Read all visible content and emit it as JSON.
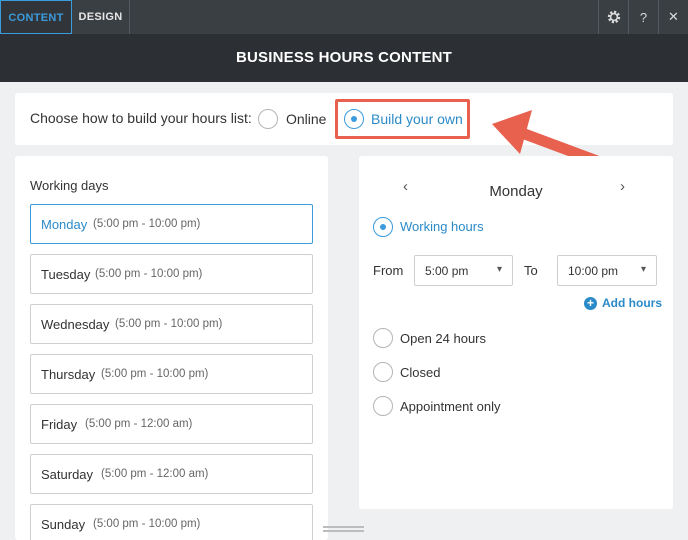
{
  "toolbar": {
    "tab_content": "CONTENT",
    "tab_design": "DESIGN",
    "help_label": "?",
    "close_label": "✕"
  },
  "header": {
    "title": "BUSINESS HOURS CONTENT"
  },
  "choose": {
    "label": "Choose how to build your hours list:",
    "option_online": "Online",
    "option_build": "Build your own",
    "selected": "Build your own"
  },
  "days": {
    "title": "Working days",
    "items": [
      {
        "name": "Monday",
        "hours": "(5:00 pm - 10:00 pm)"
      },
      {
        "name": "Tuesday",
        "hours": "(5:00 pm - 10:00 pm)"
      },
      {
        "name": "Wednesday",
        "hours": "(5:00 pm - 10:00 pm)"
      },
      {
        "name": "Thursday",
        "hours": "(5:00 pm - 10:00 pm)"
      },
      {
        "name": "Friday",
        "hours": "(5:00 pm - 12:00 am)"
      },
      {
        "name": "Saturday",
        "hours": "(5:00 pm - 12:00 am)"
      },
      {
        "name": "Sunday",
        "hours": "(5:00 pm - 10:00 pm)"
      }
    ]
  },
  "detail": {
    "day": "Monday",
    "prev_arrow": "‹",
    "next_arrow": "›",
    "working_hours": "Working hours",
    "from_label": "From",
    "from_value": "5:00 pm",
    "to_label": "To",
    "to_value": "10:00 pm",
    "add_hours": "Add hours",
    "open_24": "Open 24 hours",
    "closed": "Closed",
    "appointment": "Appointment only"
  },
  "colors": {
    "accent": "#3b9bdc",
    "highlight": "#e8614e",
    "header_bg": "#2c2f33"
  }
}
